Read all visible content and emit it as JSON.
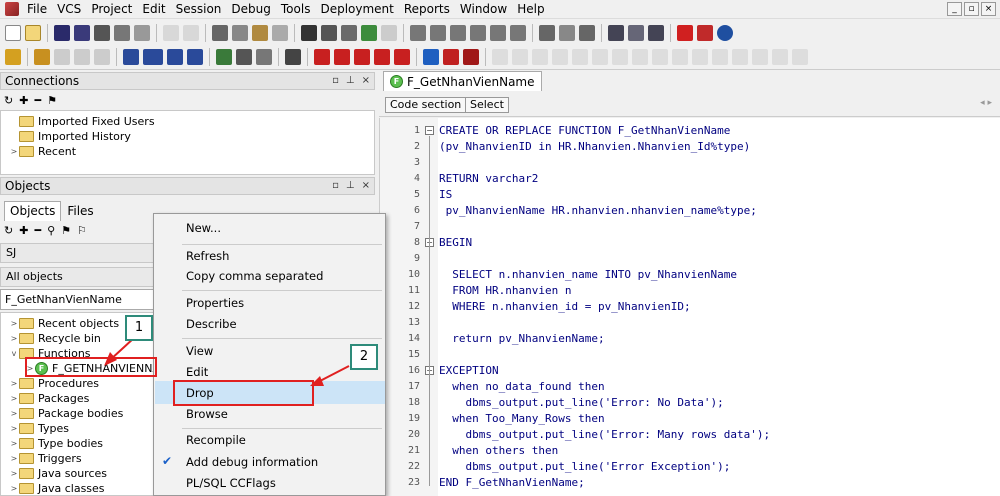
{
  "menubar": {
    "items": [
      "File",
      "VCS",
      "Project",
      "Edit",
      "Session",
      "Debug",
      "Tools",
      "Deployment",
      "Reports",
      "Window",
      "Help"
    ]
  },
  "connections": {
    "title": "Connections",
    "items": [
      {
        "label": "Imported Fixed Users",
        "expander": ""
      },
      {
        "label": "Imported History",
        "expander": ""
      },
      {
        "label": "Recent",
        "expander": ">"
      }
    ]
  },
  "objects": {
    "title": "Objects",
    "tabs": [
      "Objects",
      "Files"
    ],
    "schema": "SJ",
    "filter_type": "All objects",
    "filter_text": "F_GetNhanVienName",
    "tree": [
      {
        "label": "Recent objects",
        "expander": ">"
      },
      {
        "label": "Recycle bin",
        "expander": ">"
      },
      {
        "label": "Functions",
        "expander": "v"
      },
      {
        "label": "F_GETNHANVIENNA",
        "expander": ">",
        "kind": "function"
      },
      {
        "label": "Procedures",
        "expander": ">"
      },
      {
        "label": "Packages",
        "expander": ">"
      },
      {
        "label": "Package bodies",
        "expander": ">"
      },
      {
        "label": "Types",
        "expander": ">"
      },
      {
        "label": "Type bodies",
        "expander": ">"
      },
      {
        "label": "Triggers",
        "expander": ">"
      },
      {
        "label": "Java sources",
        "expander": ">"
      },
      {
        "label": "Java classes",
        "expander": ">"
      }
    ]
  },
  "context_menu": {
    "items": [
      "New...",
      "Refresh",
      "Copy comma separated",
      "Properties",
      "Describe",
      "View",
      "Edit",
      "Drop",
      "Browse",
      "Recompile",
      "Add debug information",
      "PL/SQL CCFlags"
    ],
    "highlighted": "Drop",
    "checked": "Add debug information"
  },
  "callouts": {
    "step1": "1",
    "step2": "2"
  },
  "editor": {
    "tab_title": "F_GetNhanVienName",
    "buttons": {
      "code_section": "Code section",
      "select": "Select"
    },
    "lines": [
      "CREATE OR REPLACE FUNCTION F_GetNhanVienName",
      "(pv_NhanvienID in HR.Nhanvien.Nhanvien_Id%type)",
      "",
      "RETURN varchar2",
      "IS",
      " pv_NhanvienName HR.nhanvien.nhanvien_name%type;",
      "",
      "BEGIN",
      "",
      "  SELECT n.nhanvien_name INTO pv_NhanvienName",
      "  FROM HR.nhanvien n",
      "  WHERE n.nhanvien_id = pv_NhanvienID;",
      "",
      "  return pv_NhanvienName;",
      "",
      "EXCEPTION",
      "  when no_data_found then",
      "    dbms_output.put_line('Error: No Data');",
      "  when Too_Many_Rows then",
      "    dbms_output.put_line('Error: Many rows data');",
      "  when others then",
      "    dbms_output.put_line('Error Exception');",
      "END F_GetNhanVienName;"
    ]
  },
  "colors": {
    "highlight": "#cce4f7",
    "callout_red": "#e02020",
    "badge_border": "#2e8b7a"
  }
}
